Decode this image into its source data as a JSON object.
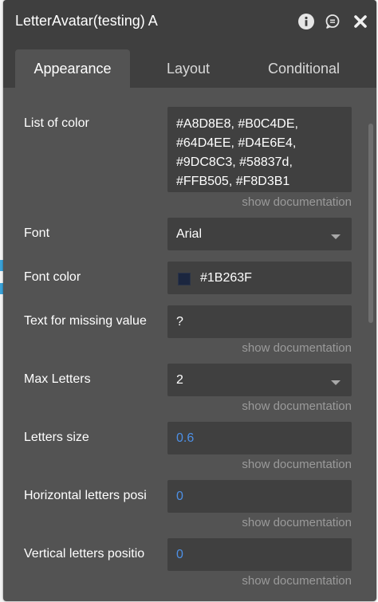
{
  "window": {
    "title": "LetterAvatar(testing) A",
    "info_icon": "info-icon",
    "comment_icon": "comment-icon",
    "close_icon": "close-icon"
  },
  "tabs": [
    {
      "label": "Appearance",
      "active": true
    },
    {
      "label": "Layout",
      "active": false
    },
    {
      "label": "Conditional",
      "active": false
    }
  ],
  "properties": {
    "list_of_color": {
      "label": "List of color",
      "value": "#A8D8E8, #B0C4DE, #64D4EE, #D4E6E4, #9DC8C3, #58837d, #FFB505, #F8D3B1",
      "doc": "show documentation"
    },
    "font": {
      "label": "Font",
      "value": "Arial"
    },
    "font_color": {
      "label": "Font color",
      "value": "#1B263F",
      "swatch_color": "#1B263F"
    },
    "text_missing": {
      "label": "Text for missing value",
      "value": "?",
      "doc": "show documentation"
    },
    "max_letters": {
      "label": "Max Letters",
      "value": "2",
      "doc": "show documentation"
    },
    "letters_size": {
      "label": "Letters size",
      "value": "0.6",
      "doc": "show documentation"
    },
    "horizontal_pos": {
      "label": "Horizontal letters posi",
      "value": "0",
      "doc": "show documentation"
    },
    "vertical_pos": {
      "label": "Vertical letters positio",
      "value": "0",
      "doc": "show documentation"
    }
  },
  "colors": {
    "panel_bg": "#535353",
    "header_bg": "#3f3f3f",
    "field_bg": "#404040",
    "number_accent": "#4d90e6",
    "doc_text": "#9a9a9a"
  }
}
